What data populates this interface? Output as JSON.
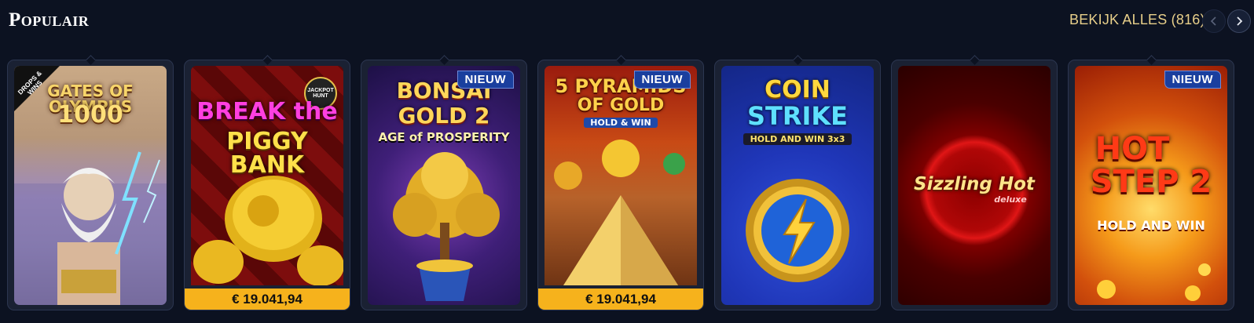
{
  "section": {
    "title": "Populair",
    "view_all": "BEKIJK ALLES (816)"
  },
  "games": [
    {
      "name": "Gates of Olympus 1000",
      "art_lines": [
        "GATES OF OLYMPUS",
        "1000"
      ],
      "tag": "DROPS & WINS",
      "new_badge": "",
      "jackpot": ""
    },
    {
      "name": "Break the Piggy Bank",
      "art_lines": [
        "BREAK the",
        "PIGGY BANK"
      ],
      "tag": "JACKPOT HUNT",
      "new_badge": "",
      "jackpot": "€ 19.041,94"
    },
    {
      "name": "Bonsai Gold 2 Age of Prosperity",
      "art_lines": [
        "BONSAI",
        "GOLD 2",
        "AGE of PROSPERITY"
      ],
      "tag": "",
      "new_badge": "NIEUW",
      "jackpot": ""
    },
    {
      "name": "5 Pyramids of Gold Hold & Win",
      "art_lines": [
        "5 PYRAMIDS",
        "OF GOLD",
        "HOLD & WIN"
      ],
      "tag": "",
      "new_badge": "NIEUW",
      "jackpot": "€ 19.041,94"
    },
    {
      "name": "Coin Strike Hold and Win 3x3",
      "art_lines": [
        "COIN",
        "STRIKE",
        "HOLD AND WIN 3x3"
      ],
      "tag": "",
      "new_badge": "",
      "jackpot": ""
    },
    {
      "name": "Sizzling Hot deluxe",
      "art_lines": [
        "Sizzling Hot",
        "deluxe"
      ],
      "tag": "",
      "new_badge": "",
      "jackpot": ""
    },
    {
      "name": "Hot Step 2 Hold and Win",
      "art_lines": [
        "HOT",
        "STEP 2",
        "HOLD AND WIN"
      ],
      "tag": "",
      "new_badge": "NIEUW",
      "jackpot": ""
    }
  ]
}
